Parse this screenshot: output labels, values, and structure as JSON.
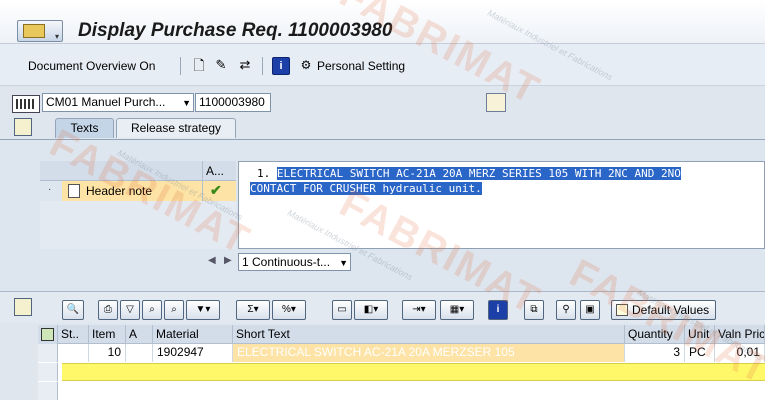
{
  "window": {
    "title": "Display Purchase Req. 1100003980"
  },
  "app_toolbar": {
    "document_overview": "Document Overview On",
    "personal_setting": "Personal Setting"
  },
  "header": {
    "doc_type": "CM01 Manuel Purch...",
    "req_number": "1100003980"
  },
  "tabs": [
    {
      "label": "Texts",
      "active": true
    },
    {
      "label": "Release strategy",
      "active": false
    }
  ],
  "text_tree": {
    "column_a": "A...",
    "rows": [
      {
        "label": "Header note",
        "selected": true,
        "has_text": true
      }
    ]
  },
  "text_editor": {
    "line1_number": "1.",
    "line1_text": "ELECTRICAL SWITCH AC-21A 20A MERZ SERIES 105 WITH 2NC AND 2NO",
    "line2_text": "CONTACT FOR CRUSHER hydraulic unit.",
    "format": "1 Continuous-t..."
  },
  "item_toolbar": {
    "default_values": "Default Values"
  },
  "grid": {
    "columns": [
      "St..",
      "Item",
      "A",
      "Material",
      "Short Text",
      "Quantity",
      "Unit",
      "Valn Pric"
    ],
    "rows": [
      {
        "status": "",
        "item": "10",
        "a": "",
        "material": "1902947",
        "short_text": "ELECTRICAL SWITCH AC-21A 20A MERZSER 105",
        "quantity": "3",
        "unit": "PC",
        "valn_price": "0,01"
      }
    ]
  },
  "watermark": {
    "brand": "FABRIMAT",
    "tagline": "Matériaux Industriel et Fabrications"
  },
  "colors": {
    "selection_highlight": "#2a65c8",
    "row_highlight": "#fde3a5",
    "new_row_yellow": "#fff96a",
    "check_green": "#3a8a1a"
  }
}
